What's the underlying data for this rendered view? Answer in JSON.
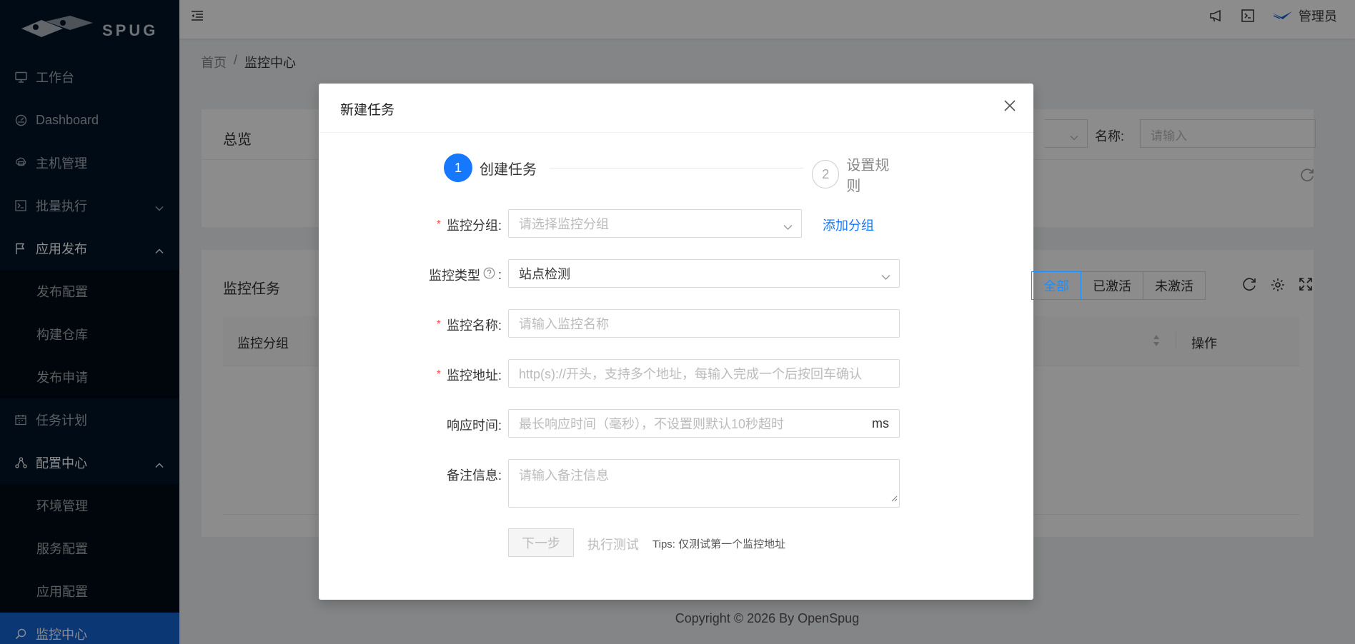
{
  "app": {
    "logo_text": "SPUG"
  },
  "sidebar": {
    "items": [
      {
        "label": "工作台",
        "icon": "desktop-icon"
      },
      {
        "label": "Dashboard",
        "icon": "dashboard-icon"
      },
      {
        "label": "主机管理",
        "icon": "cloud-server-icon"
      },
      {
        "label": "批量执行",
        "icon": "terminal-icon"
      },
      {
        "label": "应用发布",
        "icon": "flag-icon"
      },
      {
        "label": "发布配置"
      },
      {
        "label": "构建仓库"
      },
      {
        "label": "发布申请"
      },
      {
        "label": "任务计划",
        "icon": "schedule-icon"
      },
      {
        "label": "配置中心",
        "icon": "apartment-icon"
      },
      {
        "label": "环境管理"
      },
      {
        "label": "服务配置"
      },
      {
        "label": "应用配置"
      },
      {
        "label": "监控中心",
        "icon": "monitor-icon"
      }
    ]
  },
  "header": {
    "user": "管理员"
  },
  "breadcrumb": {
    "home": "首页",
    "sep": "/",
    "current": "监控中心"
  },
  "overview": {
    "title": "总览",
    "name_label": "名称:",
    "name_placeholder": "请输入"
  },
  "tasks": {
    "title": "监控任务",
    "filters": [
      "全部",
      "已激活",
      "未激活"
    ],
    "col_group": "监控分组",
    "col_actions": "操作"
  },
  "footer": {
    "text": "Copyright © 2026 By OpenSpug"
  },
  "modal": {
    "title": "新建任务",
    "steps": [
      {
        "num": "1",
        "label": "创建任务"
      },
      {
        "num": "2",
        "label": "设置规则"
      }
    ],
    "fields": {
      "group": {
        "label": "监控分组:",
        "placeholder": "请选择监控分组",
        "add": "添加分组"
      },
      "type": {
        "label": "监控类型",
        "colon": ":",
        "value": "站点检测"
      },
      "name": {
        "label": "监控名称:",
        "placeholder": "请输入监控名称"
      },
      "addr": {
        "label": "监控地址:",
        "placeholder": "http(s)://开头，支持多个地址，每输入完成一个后按回车确认"
      },
      "timeout": {
        "label": "响应时间:",
        "placeholder": "最长响应时间（毫秒），不设置则默认10秒超时",
        "suffix": "ms"
      },
      "desc": {
        "label": "备注信息:",
        "placeholder": "请输入备注信息"
      }
    },
    "buttons": {
      "next": "下一步",
      "test": "执行测试",
      "tips": "Tips: 仅测试第一个监控地址"
    }
  }
}
